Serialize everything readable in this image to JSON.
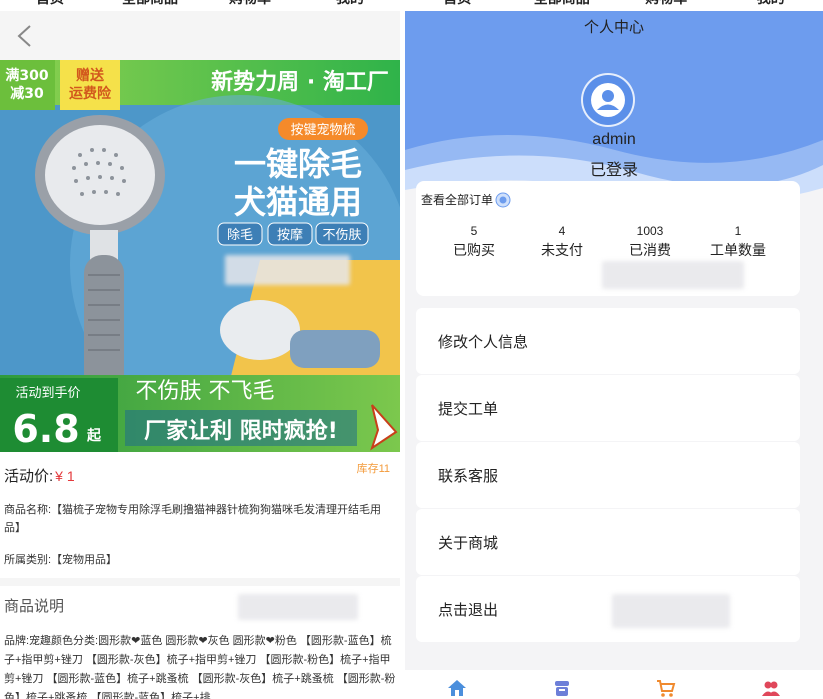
{
  "nav": {
    "items": [
      "首页",
      "全部商品",
      "购物车",
      "我的"
    ]
  },
  "product": {
    "banner": {
      "brand": "新势力周 · 淘工厂",
      "promo_top_1": "满300",
      "promo_top_2": "减30",
      "promo_top_3": "赠送",
      "promo_top_4": "运费险",
      "tag": "按键宠物梳",
      "headline_1": "一键除毛",
      "headline_2": "犬猫通用",
      "feature_1": "除毛",
      "feature_2": "按摩",
      "feature_3": "不伤肤",
      "price_caption": "活动到手价",
      "price_big": "6.8",
      "price_unit": "起",
      "slogan_1": "不伤肤 不飞毛",
      "slogan_2": "厂家让利 限时疯抢!"
    },
    "price_label": "活动价:",
    "price_value": "¥ 1",
    "stock": "库存11",
    "name": "商品名称:【猫梳子宠物专用除浮毛刷撸猫神器针梳狗狗猫咪毛发清理开结毛用品】",
    "category": "所属类别:【宠物用品】",
    "desc_title": "商品说明",
    "desc_body": "品牌:宠趣颜色分类:圆形款❤蓝色 圆形款❤灰色 圆形款❤粉色 【圆形款-蓝色】梳子+指甲剪+锉刀 【圆形款-灰色】梳子+指甲剪+锉刀 【圆形款-粉色】梳子+指甲剪+锉刀 【圆形款-蓝色】梳子+跳蚤梳 【圆形款-灰色】梳子+跳蚤梳 【圆形款-粉色】梳子+跳蚤梳 【圆形款-蓝色】梳子+排"
  },
  "profile": {
    "title": "个人中心",
    "username": "admin",
    "status": "已登录",
    "orders_link": "查看全部订单",
    "stats": [
      {
        "num": "5",
        "label": "已购买"
      },
      {
        "num": "4",
        "label": "未支付"
      },
      {
        "num": "1003",
        "label": "已消费"
      },
      {
        "num": "1",
        "label": "工单数量"
      }
    ],
    "menu": [
      "修改个人信息",
      "提交工单",
      "联系客服",
      "关于商城",
      "点击退出"
    ]
  },
  "colors": {
    "accent": "#6d9cee",
    "price": "#e4393c",
    "stock": "#f39a3a"
  }
}
